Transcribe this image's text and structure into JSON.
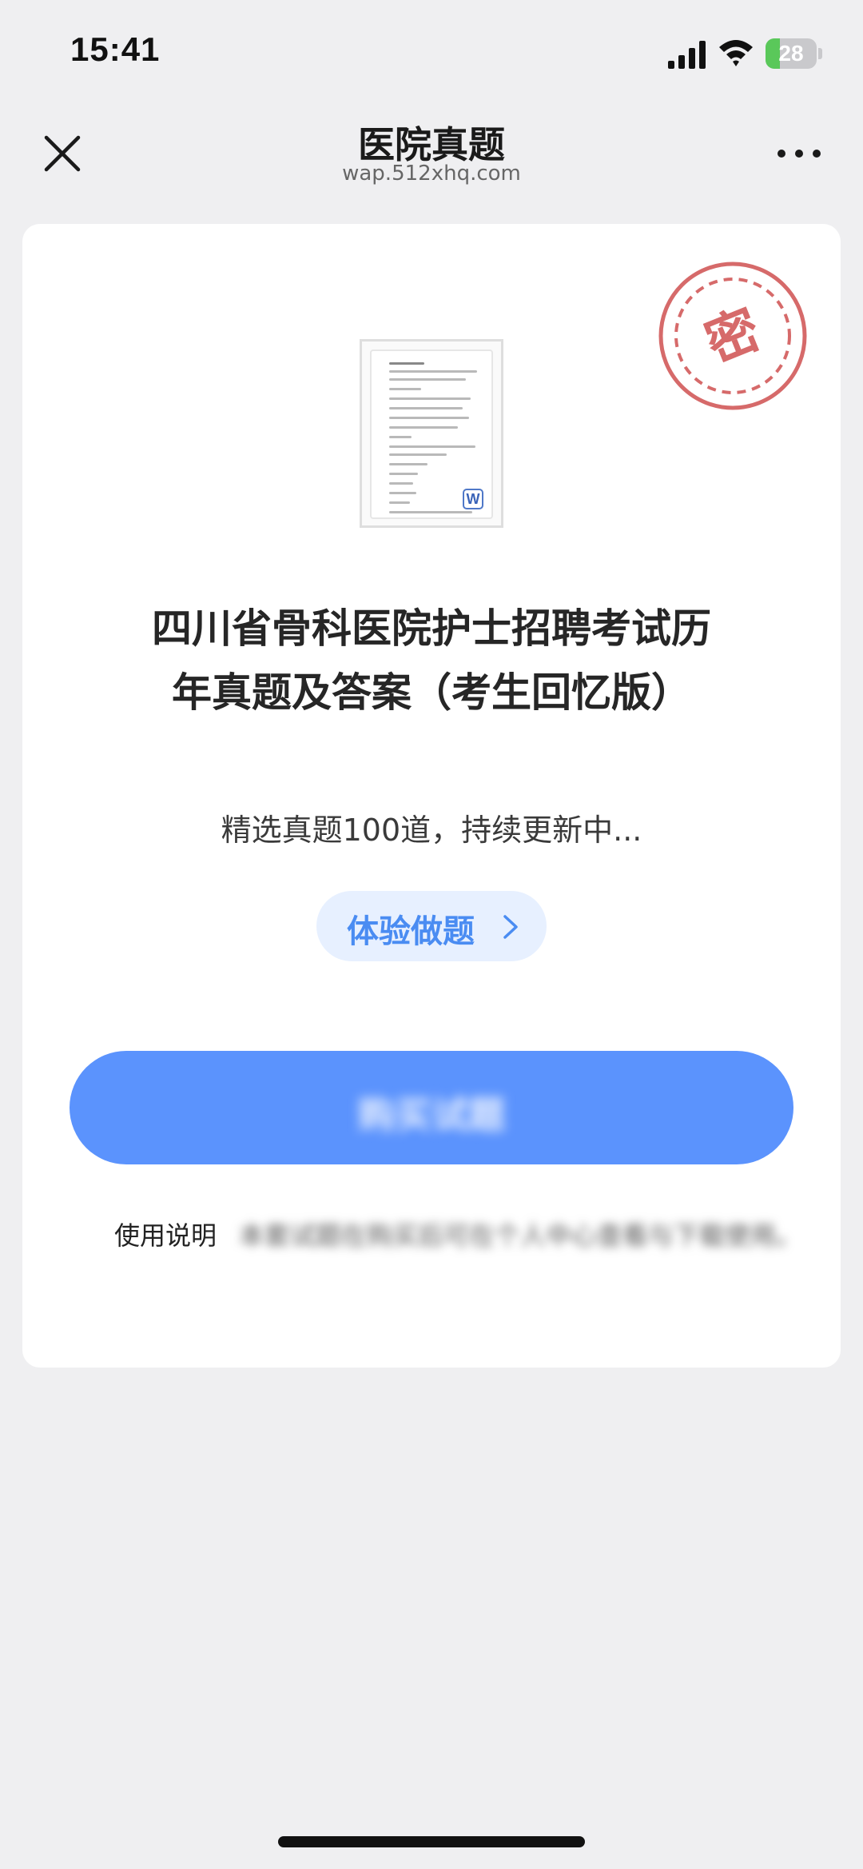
{
  "status_bar": {
    "time": "15:41",
    "battery_level": "28",
    "battery_fraction": 0.28
  },
  "nav": {
    "title": "医院真题",
    "url": "wap.512xhq.com",
    "close_icon": "close-icon",
    "more_icon": "more-icon"
  },
  "card": {
    "stamp_text": "密",
    "doc_icon": "word-document-icon",
    "title": "四川省骨科医院护士招聘考试历年真题及答案（考生回忆版）",
    "subtitle": "精选真题100道，持续更新中...",
    "trial_button_label": "体验做题",
    "buy_button_label": "购买试题",
    "usage_label": "使用说明",
    "usage_text": "本套试题在购买后可在个人中心查看与下载使用。"
  },
  "colors": {
    "background": "#efeff1",
    "card": "#ffffff",
    "primary_button": "#5b93fd",
    "trial_button_bg": "#e7f0ff",
    "trial_button_text": "#4a8cf2",
    "stamp_red": "#d66a6a"
  }
}
